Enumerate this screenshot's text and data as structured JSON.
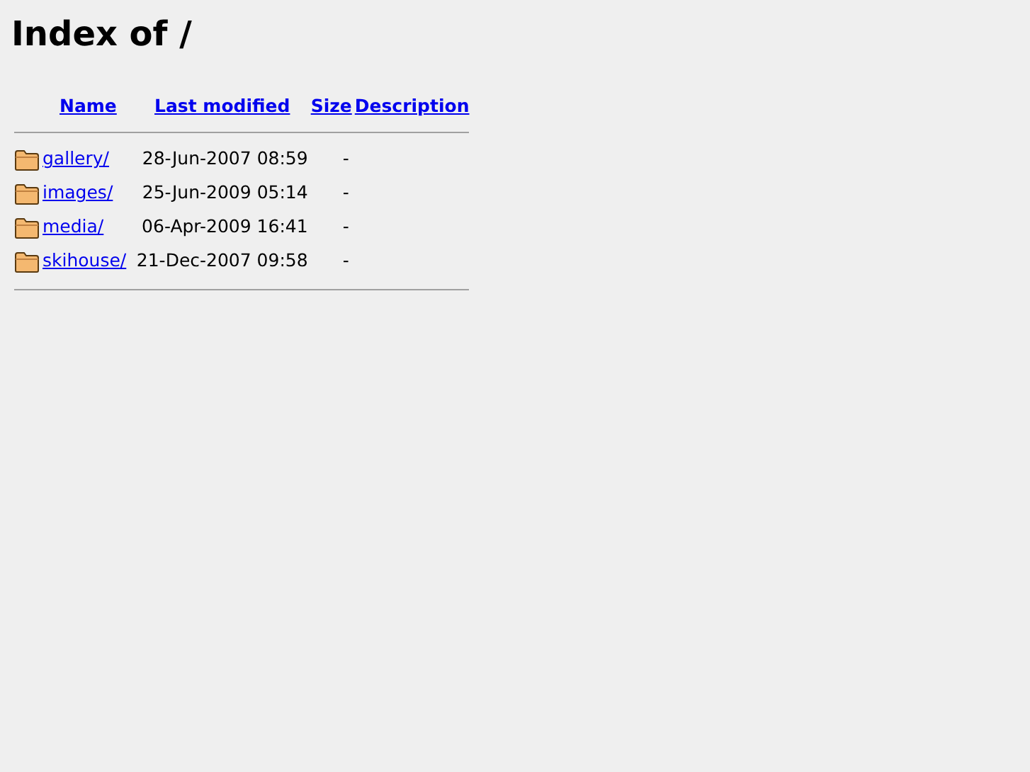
{
  "title": "Index of /",
  "columns": [
    "Name",
    "Last modified",
    "Size",
    "Description"
  ],
  "rows": [
    {
      "name": "gallery/",
      "modified": "28-Jun-2007 08:59",
      "size": "-"
    },
    {
      "name": "images/",
      "modified": "25-Jun-2009 05:14",
      "size": "-"
    },
    {
      "name": "media/",
      "modified": "06-Apr-2009 16:41",
      "size": "-"
    },
    {
      "name": "skihouse/",
      "modified": "21-Dec-2007 09:58",
      "size": "-"
    }
  ]
}
